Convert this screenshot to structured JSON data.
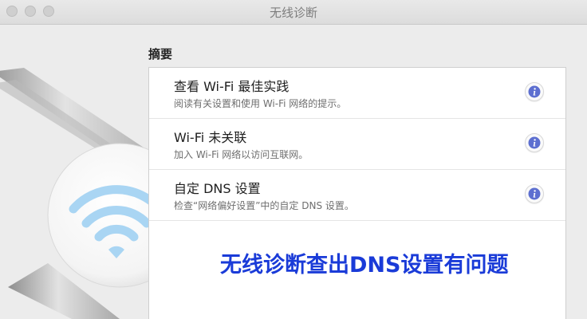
{
  "window": {
    "title": "无线诊断"
  },
  "summary": {
    "label": "摘要"
  },
  "items": [
    {
      "title": "查看 Wi-Fi 最佳实践",
      "description": "阅读有关设置和使用 Wi-Fi 网络的提示。"
    },
    {
      "title": "Wi-Fi 未关联",
      "description": "加入 Wi-Fi 网络以访问互联网。"
    },
    {
      "title": "自定 DNS 设置",
      "description": "检查“网络偏好设置”中的自定 DNS 设置。"
    }
  ],
  "overlay": {
    "caption": "无线诊断查出DNS设置有问题"
  },
  "icons": {
    "info": "info-icon",
    "wifi": "wifi-icon"
  },
  "colors": {
    "overlay_text": "#1a3bd8",
    "info_accent": "#5d6fd0",
    "wifi_blue": "#8cc8f0"
  }
}
